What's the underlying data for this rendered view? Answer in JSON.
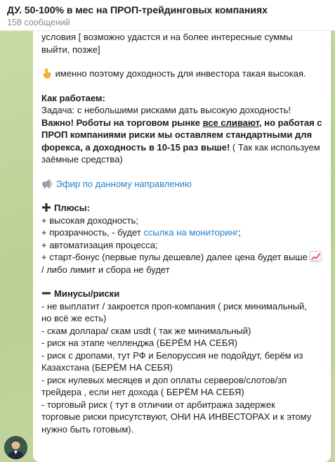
{
  "header": {
    "title": "ДУ. 50-100% в мес на ПРОП-трейдинговых компаниях",
    "subtitle": "158 сообщений"
  },
  "message": {
    "l1": "условия [ возможно удастся и на более интересные суммы",
    "l2": "выйти, позже]",
    "l3": "именно поэтому доходность для инвестора такая высокая.",
    "how_title": "Как работаем:",
    "task": "Задача: с небольшими рисками дать высокую доходность!",
    "imp_a": "Важно! Роботы на торговом рынке ",
    "imp_link": "все сливают",
    "imp_b": ", но работая с",
    "imp_c": "ПРОП компаниями риски мы оставляем стандартными для",
    "imp_d": "форекса, а доходность в 10-15 раз выше!",
    "imp_e": " ( Так как используем",
    "imp_f": "заёмные средства)",
    "efir": "Эфир по данному направлению",
    "plus_title": "Плюсы:",
    "plus1": "+ высокая доходность;",
    "plus2a": "+ прозрачность, - будет ",
    "plus2_link": "ссылка на мониторинг",
    "plus2b": ";",
    "plus3": "+ автоматизация процесса;",
    "plus4": "+ старт-бонус (первые пулы дешевле) далее цена будет выше",
    "plus5": "/ либо лимит и сбора не будет",
    "minus_title": "Минусы/риски",
    "m1": "- не выплатит / закроется проп-компания ( риск минимальный,",
    "m2": "но всё же есть)",
    "m3": "- скам доллара/ скам usdt ( так же минимальный)",
    "m4": "- риск на этапе челленджа (БЕРЁМ НА СЕБЯ)",
    "m5": "- риск с дропами, тут РФ  и Белоруссия не подойдут, берём из",
    "m6": "Казахстана (БЕРЁМ НА СЕБЯ)",
    "m7": "- риск нулевых месяцев и доп оплаты серверов/слотов/зп",
    "m8": "трейдера , если нет дохода ( БЕРЁМ НА СЕБЯ)",
    "m9": "- торговый риск ( тут в отличии от арбитража задержек",
    "m10": "торговые риски присутствуют, ОНИ НА ИНВЕСТОРАХ и к этому",
    "m11": "нужно быть готовым)."
  },
  "icons": {
    "hand": "pointing-hand-icon",
    "mega": "megaphone-icon",
    "plus": "plus-icon",
    "minus": "minus-icon",
    "chart": "chart-up-icon"
  },
  "colors": {
    "link": "#2481cc",
    "wallpaper": "#c9d9a8"
  }
}
